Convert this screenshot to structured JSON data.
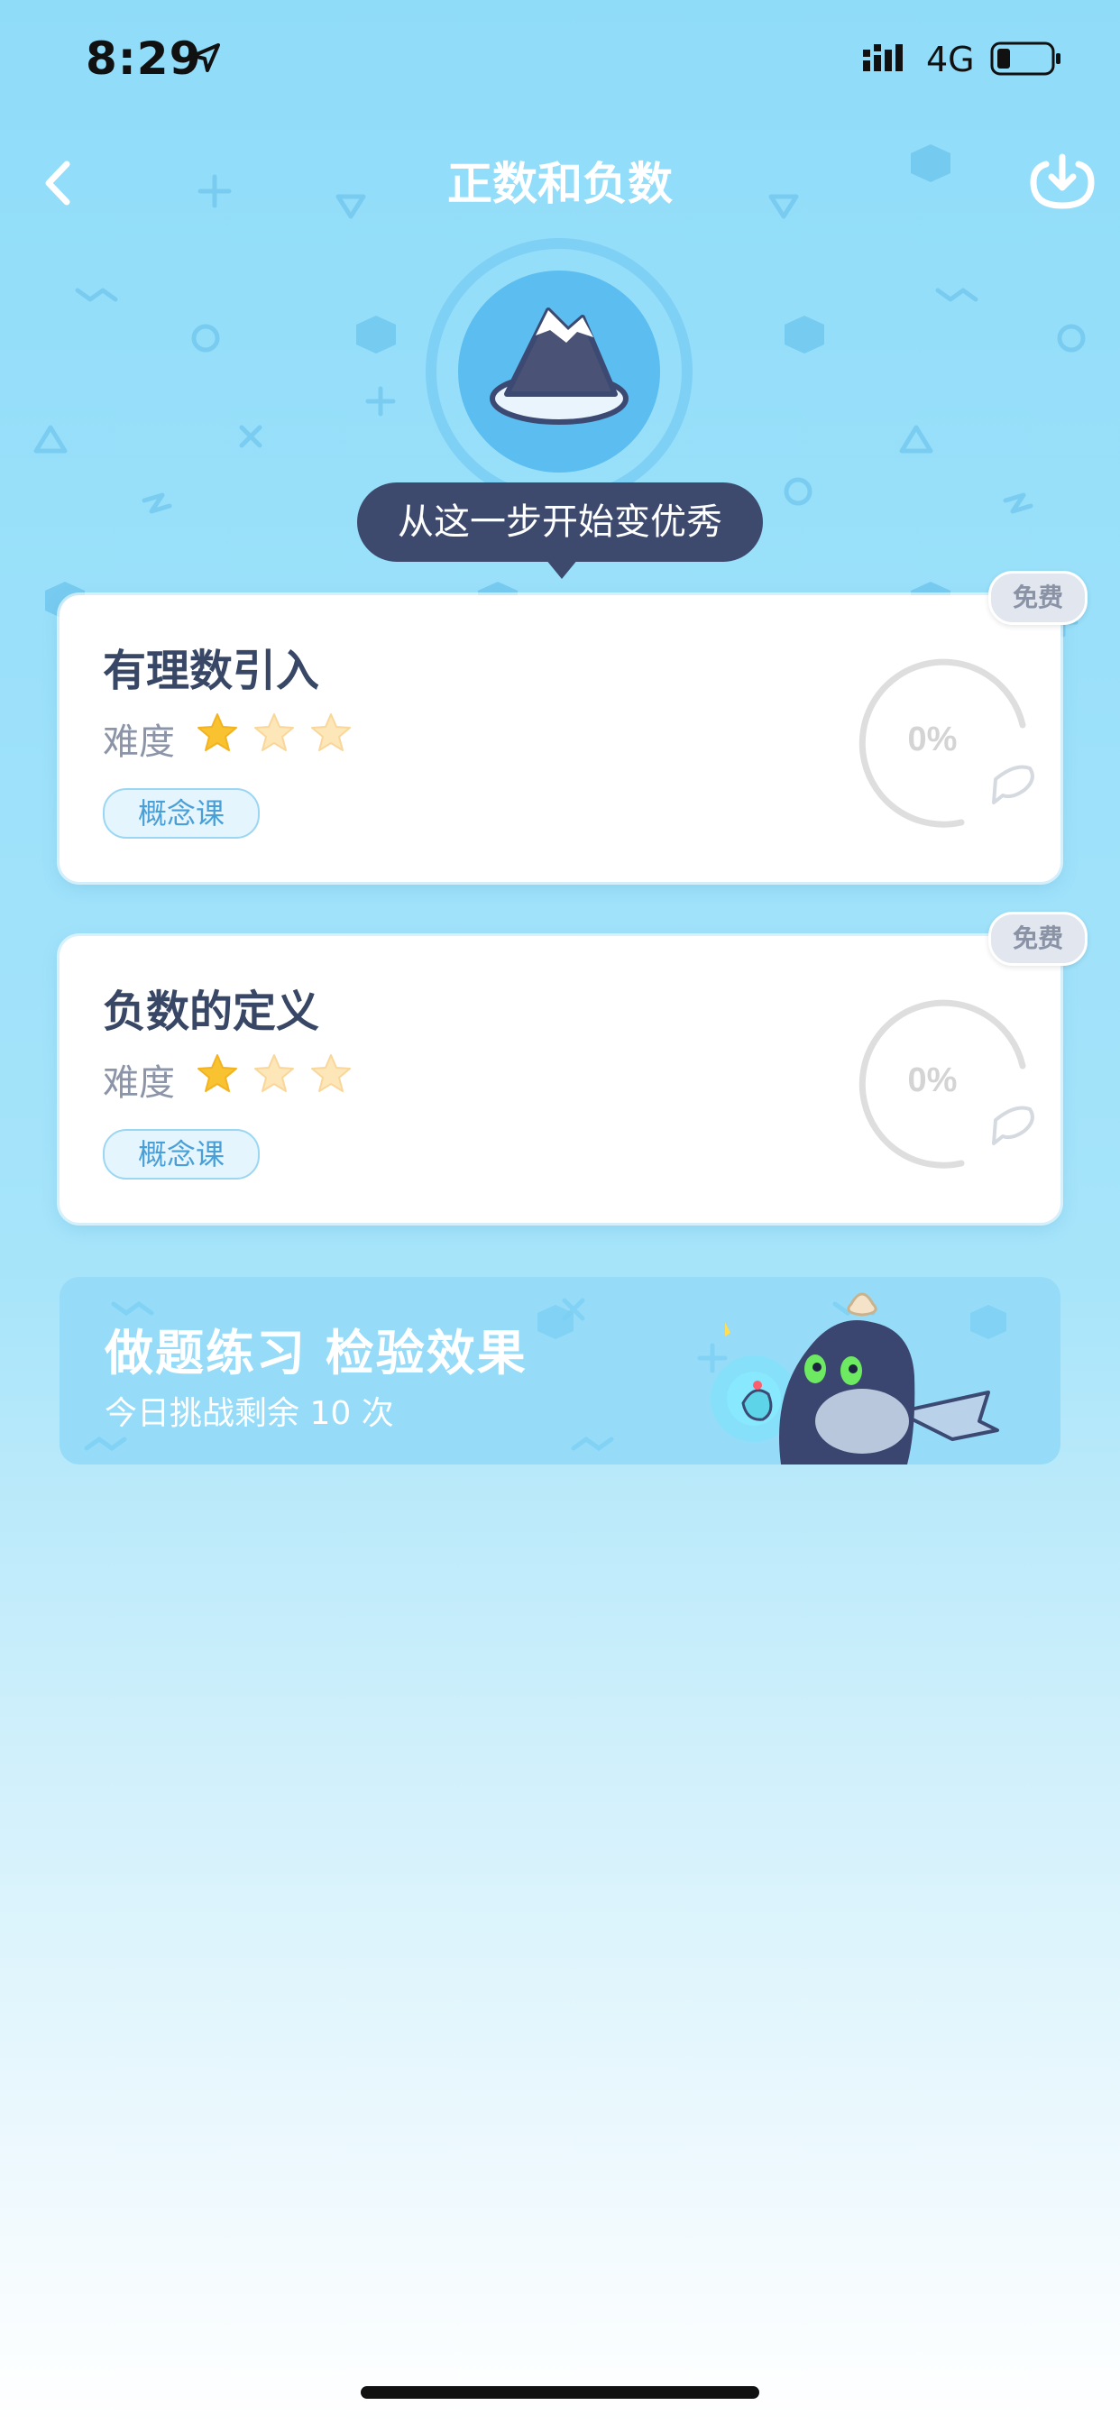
{
  "status_bar": {
    "time": "8:29",
    "network": "4G"
  },
  "nav": {
    "title": "正数和负数"
  },
  "tooltip": {
    "text": "从这一步开始变优秀"
  },
  "lessons": [
    {
      "title": "有理数引入",
      "difficulty_label": "难度",
      "stars_filled": 1,
      "stars_total": 3,
      "tag": "概念课",
      "progress": "0%",
      "badge": "免费"
    },
    {
      "title": "负数的定义",
      "difficulty_label": "难度",
      "stars_filled": 1,
      "stars_total": 3,
      "tag": "概念课",
      "progress": "0%",
      "badge": "免费"
    }
  ],
  "practice_banner": {
    "title": "做题练习  检验效果",
    "subtitle": "今日挑战剩余 10 次"
  },
  "colors": {
    "accent": "#3d4a6e",
    "star_filled": "#f8c230",
    "star_empty": "#fde6b8",
    "tag": "#4a9fd6"
  }
}
